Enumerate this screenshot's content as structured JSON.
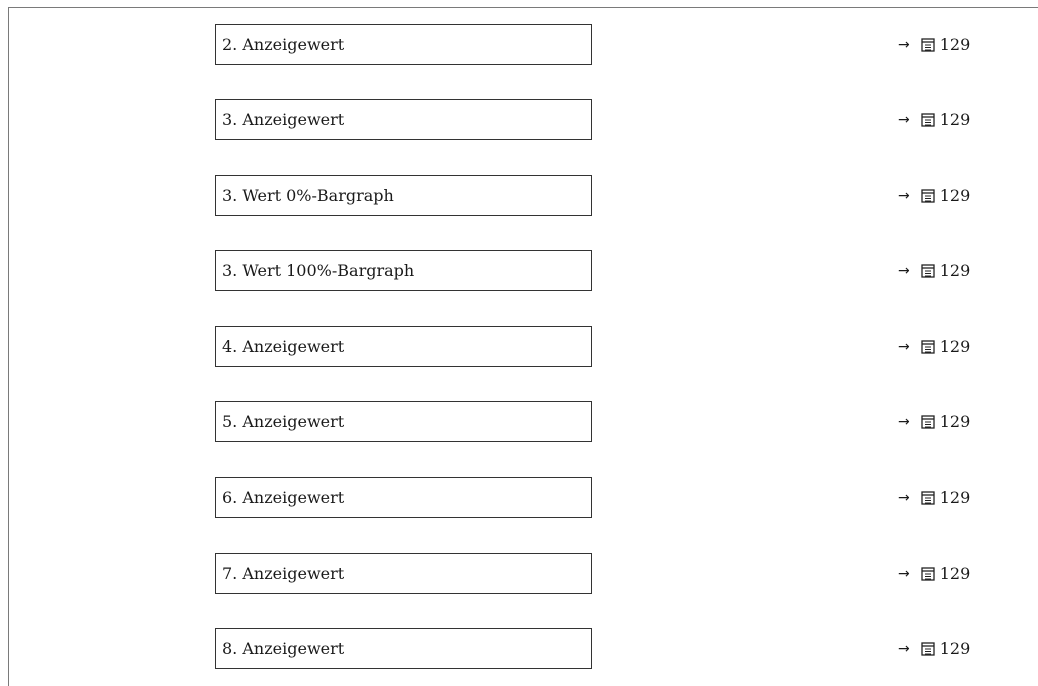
{
  "rows": [
    {
      "label": "2. Anzeigewert",
      "page": "129"
    },
    {
      "label": "3. Anzeigewert",
      "page": "129"
    },
    {
      "label": "3. Wert 0%-Bargraph",
      "page": "129"
    },
    {
      "label": "3. Wert 100%-Bargraph",
      "page": "129"
    },
    {
      "label": "4. Anzeigewert",
      "page": "129"
    },
    {
      "label": "5. Anzeigewert",
      "page": "129"
    },
    {
      "label": "6. Anzeigewert",
      "page": "129"
    },
    {
      "label": "7. Anzeigewert",
      "page": "129"
    },
    {
      "label": "8. Anzeigewert",
      "page": "129"
    }
  ],
  "icons": {
    "arrow": "right-arrow-icon",
    "page_ref": "book-icon",
    "arrow_glyph": "→"
  }
}
